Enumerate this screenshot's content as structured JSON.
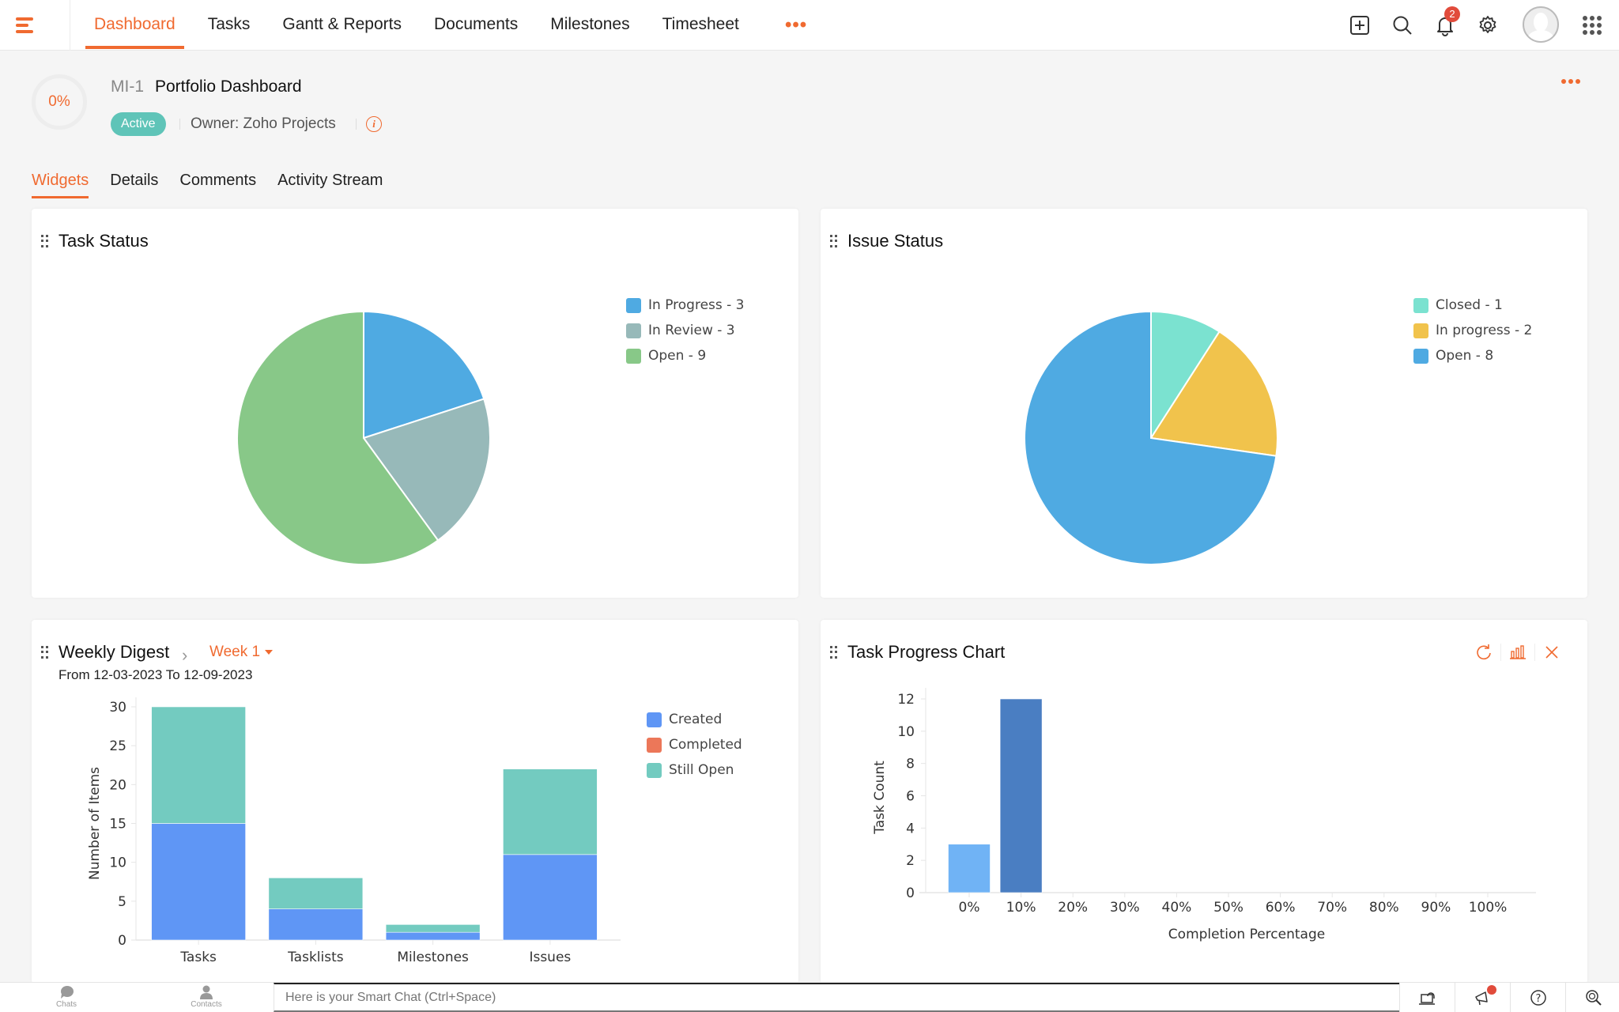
{
  "nav": {
    "tabs": [
      {
        "label": "Dashboard",
        "active": true
      },
      {
        "label": "Tasks"
      },
      {
        "label": "Gantt & Reports"
      },
      {
        "label": "Documents"
      },
      {
        "label": "Milestones"
      },
      {
        "label": "Timesheet"
      }
    ],
    "more_label": "•••",
    "notification_count": "2",
    "icons": [
      "menu-icon",
      "add-icon",
      "search-icon",
      "bell-icon",
      "gear-icon",
      "avatar",
      "apps-grid-icon"
    ],
    "accent": "#f06a30"
  },
  "project": {
    "progress": "0%",
    "id": "MI-1",
    "title": "Portfolio Dashboard",
    "status": "Active",
    "status_color": "#5fc4b8",
    "owner_label": "Owner:",
    "owner": "Zoho Projects"
  },
  "subtabs": [
    {
      "label": "Widgets",
      "active": true
    },
    {
      "label": "Details"
    },
    {
      "label": "Comments"
    },
    {
      "label": "Activity Stream"
    }
  ],
  "widgets": {
    "task_status": {
      "title": "Task Status"
    },
    "issue_status": {
      "title": "Issue Status"
    },
    "weekly_digest": {
      "title": "Weekly Digest",
      "week": "Week 1",
      "range": "From 12-03-2023 To 12-09-2023"
    },
    "task_progress": {
      "title": "Task Progress Chart",
      "actions": [
        "refresh-icon",
        "chart-type-icon",
        "close-icon"
      ]
    }
  },
  "chart_data": [
    {
      "id": "task_status",
      "type": "pie",
      "title": "Task Status",
      "legend_position": "top-right",
      "slices": [
        {
          "label": "In Progress - 3",
          "name": "In Progress",
          "value": 3,
          "color": "#4faae2"
        },
        {
          "label": "In Review - 3",
          "name": "In Review",
          "value": 3,
          "color": "#97b9b9"
        },
        {
          "label": "Open - 9",
          "name": "Open",
          "value": 9,
          "color": "#88c888"
        }
      ]
    },
    {
      "id": "issue_status",
      "type": "pie",
      "title": "Issue Status",
      "legend_position": "top-right",
      "slices": [
        {
          "label": "Closed - 1",
          "name": "Closed",
          "value": 1,
          "color": "#7be2d0"
        },
        {
          "label": "In progress - 2",
          "name": "In progress",
          "value": 2,
          "color": "#f1c34c"
        },
        {
          "label": "Open - 8",
          "name": "Open",
          "value": 8,
          "color": "#4faae2"
        }
      ]
    },
    {
      "id": "weekly_digest",
      "type": "bar",
      "stacked": true,
      "title": "Weekly Digest",
      "xlabel": "",
      "ylabel": "Number of Items",
      "ylim": [
        0,
        30
      ],
      "yticks": [
        0,
        5,
        10,
        15,
        20,
        25,
        30
      ],
      "categories": [
        "Tasks",
        "Tasklists",
        "Milestones",
        "Issues"
      ],
      "legend_position": "top-right",
      "series": [
        {
          "name": "Created",
          "values": [
            15,
            4,
            1,
            11
          ],
          "color": "#5f96f5"
        },
        {
          "name": "Completed",
          "values": [
            0,
            0,
            0,
            0
          ],
          "color": "#ec7759"
        },
        {
          "name": "Still Open",
          "values": [
            15,
            4,
            1,
            11
          ],
          "color": "#73cbc0"
        }
      ]
    },
    {
      "id": "task_progress",
      "type": "bar",
      "title": "Task Progress Chart",
      "xlabel": "Completion Percentage",
      "ylabel": "Task Count",
      "ylim": [
        0,
        12
      ],
      "yticks": [
        0,
        2,
        4,
        6,
        8,
        10,
        12
      ],
      "categories": [
        "0%",
        "10%",
        "20%",
        "30%",
        "40%",
        "50%",
        "60%",
        "70%",
        "80%",
        "90%",
        "100%"
      ],
      "values": [
        3,
        12,
        0,
        0,
        0,
        0,
        0,
        0,
        0,
        0,
        0
      ],
      "colors": [
        "#70b3f5",
        "#4a7ec2"
      ]
    }
  ],
  "bottombar": {
    "chats_label": "Chats",
    "contacts_label": "Contacts",
    "smartchat_placeholder": "Here is your Smart Chat (Ctrl+Space)",
    "icons": [
      "support-icon",
      "announcement-icon",
      "help-icon",
      "zia-search-icon"
    ]
  }
}
